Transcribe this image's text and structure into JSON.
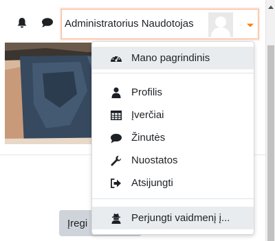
{
  "header": {
    "user_name": "Administratorius Naudotojas",
    "icons": {
      "notifications": "bell-icon",
      "messages": "comment-icon",
      "menu_toggle": "caret-down-icon"
    }
  },
  "user_menu": {
    "items": [
      {
        "label": "Mano pagrindinis",
        "icon": "tachometer-icon"
      },
      {
        "label": "Profilis",
        "icon": "user-icon"
      },
      {
        "label": "Įverčiai",
        "icon": "table-icon"
      },
      {
        "label": "Žinutės",
        "icon": "comment-icon"
      },
      {
        "label": "Nuostatos",
        "icon": "wrench-icon"
      },
      {
        "label": "Atsijungti",
        "icon": "sign-out-icon"
      },
      {
        "label": "Perjungti vaidmenį į...",
        "icon": "user-secret-icon"
      }
    ]
  },
  "content": {
    "button_label": "Įregi"
  },
  "colors": {
    "accent": "#f98012",
    "focus_border": "#f7b99a",
    "text": "#1d2125",
    "active_item_bg": "#e9ecef"
  }
}
